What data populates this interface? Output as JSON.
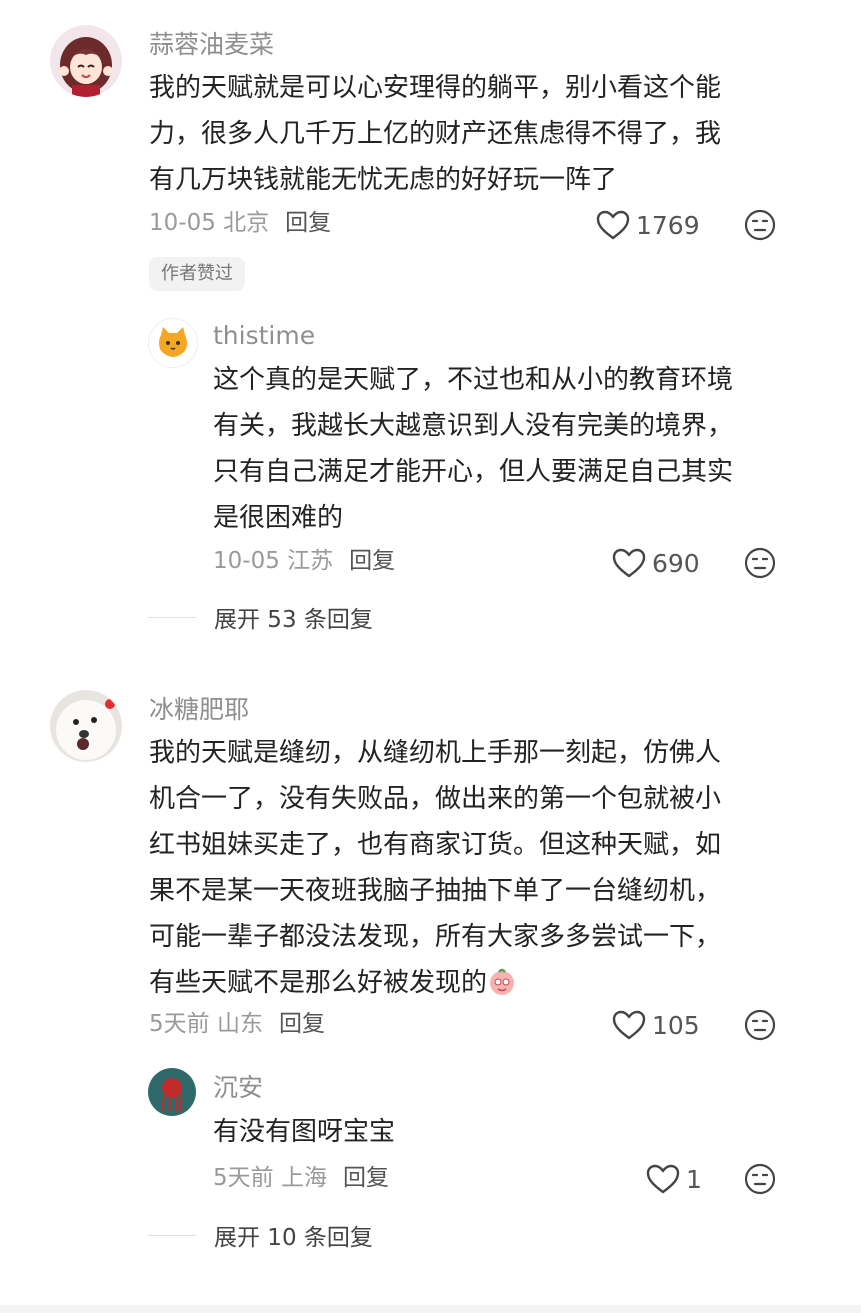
{
  "comments": [
    {
      "username": "蒜蓉油麦菜",
      "lines": [
        "我的天赋就是可以心安理得的躺平，别小看这个能",
        "力，很多人几千万上亿的财产还焦虑得不得了，我",
        "有几万块钱就能无忧无虑的好好玩一阵了"
      ],
      "meta": "10-05 北京",
      "reply_label": "回复",
      "likes": "1769",
      "badge": "作者赞过",
      "reply": {
        "username": "thistime",
        "lines": [
          "这个真的是天赋了，不过也和从小的教育环境",
          "有关，我越长大越意识到人没有完美的境界，",
          "只有自己满足才能开心，但人要满足自己其实",
          "是很困难的"
        ],
        "meta": "10-05 江苏",
        "reply_label": "回复",
        "likes": "690"
      },
      "expand_label": "展开 53 条回复"
    },
    {
      "username": "冰糖肥耶",
      "lines": [
        "我的天赋是缝纫，从缝纫机上手那一刻起，仿佛人",
        "机合一了，没有失败品，做出来的第一个包就被小",
        "红书姐妹买走了，也有商家订货。但这种天赋，如",
        "果不是某一天夜班我脑子抽抽下单了一台缝纫机，",
        "可能一辈子都没法发现，所有大家多多尝试一下，",
        "有些天赋不是那么好被发现的"
      ],
      "meta": "5天前 山东",
      "reply_label": "回复",
      "likes": "105",
      "reply": {
        "username": "沉安",
        "lines": [
          "有没有图呀宝宝"
        ],
        "meta": "5天前 上海",
        "reply_label": "回复",
        "likes": "1"
      },
      "expand_label": "展开 10 条回复"
    }
  ],
  "icons": {
    "like": "heart-outline-icon",
    "emoji": "emoji-face-icon"
  },
  "colors": {
    "username": "#8f8f8f",
    "meta": "#9a9a9a",
    "text": "#232323"
  }
}
